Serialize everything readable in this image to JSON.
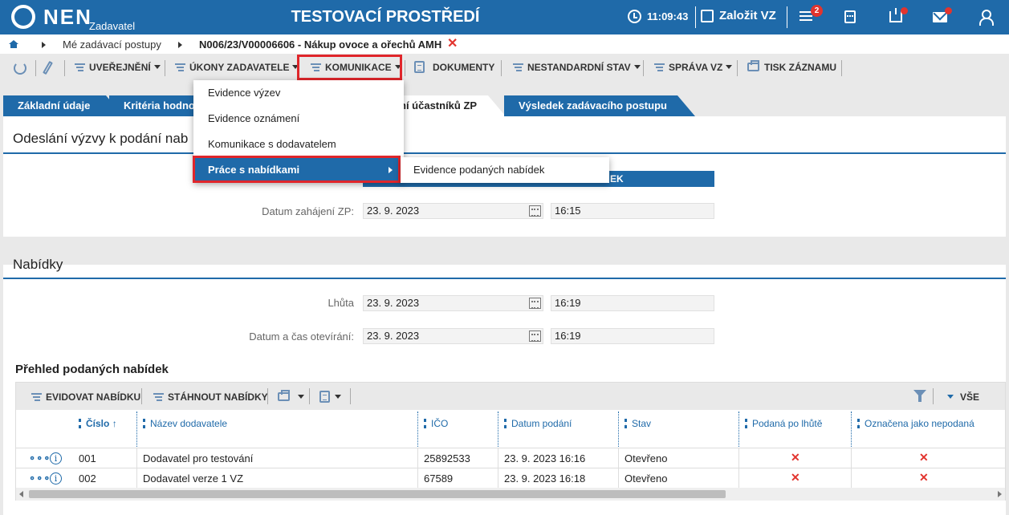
{
  "header": {
    "logo_text": "NEN",
    "logo_sub": "Zadavatel",
    "env_title": "TESTOVACÍ PROSTŘEDÍ",
    "clock": "11:09:43",
    "create_label": "Založit VZ",
    "menu_badge": "2"
  },
  "breadcrumb": {
    "item1": "Mé zadávací postupy",
    "item2": "N006/23/V00006606 - Nákup ovoce a ořechů AMH"
  },
  "toolbar": {
    "uverejneni": "UVEŘEJNĚNÍ",
    "ukony": "ÚKONY ZADAVATELE",
    "komunikace": "KOMUNIKACE",
    "dokumenty": "DOKUMENTY",
    "nestandardni": "NESTANDARDNÍ STAV",
    "sprava": "SPRÁVA VZ",
    "tisk": "TISK ZÁZNAMU"
  },
  "tabs": {
    "t1": "Základní údaje",
    "t2": "Kritéria hodno",
    "t3": "ní účastníků ZP",
    "t4": "Výsledek zadávacího postupu"
  },
  "dropdown": {
    "items": [
      "Evidence výzev",
      "Evidence oznámení",
      "Komunikace s dodavatelem",
      "Práce s nabídkami"
    ],
    "submenu": "Evidence podaných nabídek"
  },
  "section1": {
    "title": "Odeslání výzvy k podání nab",
    "header_frag": "EK",
    "date_label": "Datum zahájení ZP:",
    "date_value": "23. 9. 2023",
    "time_value": "16:15"
  },
  "section2": {
    "title": "Nabídky",
    "deadline_label": "Lhůta",
    "deadline_date": "23. 9. 2023",
    "deadline_time": "16:19",
    "open_label": "Datum a čas otevírání:",
    "open_date": "23. 9. 2023",
    "open_time": "16:19"
  },
  "grid": {
    "title": "Přehled podaných nabídek",
    "btn_evidovat": "EVIDOVAT NABÍDKU",
    "btn_stahnout": "STÁHNOUT NABÍDKY",
    "btn_vse": "VŠE",
    "columns": {
      "cislo": "Číslo",
      "nazev": "Název dodavatele",
      "ico": "IČO",
      "datum": "Datum podání",
      "stav": "Stav",
      "po_lhute": "Podaná po lhůtě",
      "nepodana": "Označena jako nepodaná"
    },
    "rows": [
      {
        "cislo": "001",
        "nazev": "Dodavatel pro testování",
        "ico": "25892533",
        "datum": "23. 9. 2023 16:16",
        "stav": "Otevřeno",
        "po_lhute": "✕",
        "nepodana": "✕"
      },
      {
        "cislo": "002",
        "nazev": "Dodavatel verze 1 VZ",
        "ico": "67589",
        "datum": "23. 9. 2023 16:18",
        "stav": "Otevřeno",
        "po_lhute": "✕",
        "nepodana": "✕"
      }
    ]
  },
  "colors": {
    "primary": "#1f6aa9",
    "danger": "#e2342e",
    "highlight": "#e0262b"
  }
}
